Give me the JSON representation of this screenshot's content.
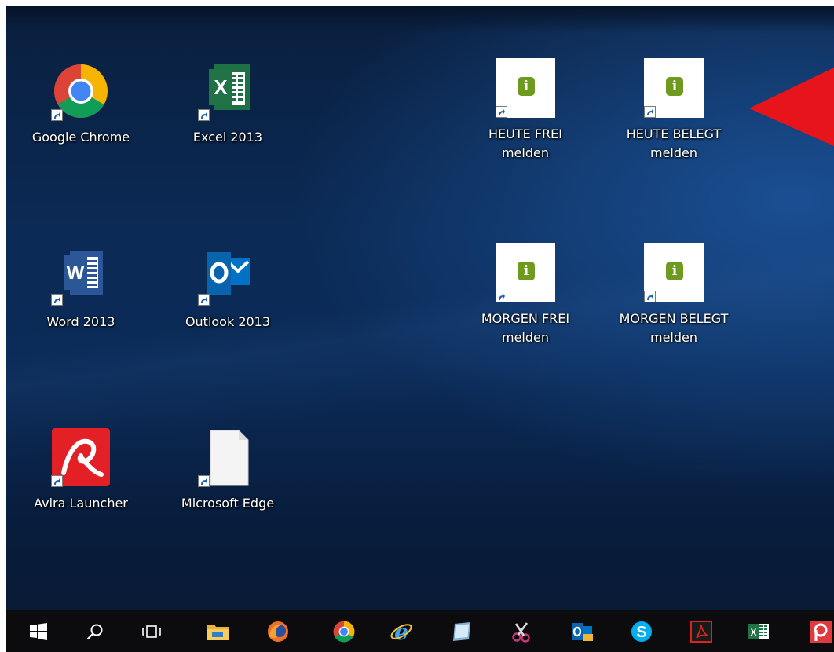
{
  "desktop": {
    "icons": [
      {
        "label": "Google Chrome",
        "icon": "chrome-icon"
      },
      {
        "label": "Excel 2013",
        "icon": "excel-icon"
      },
      {
        "label": "HEUTE FREI\nmelden",
        "icon": "info-icon"
      },
      {
        "label": "HEUTE BELEGT\nmelden",
        "icon": "info-icon"
      },
      {
        "label": "Word 2013",
        "icon": "word-icon"
      },
      {
        "label": "Outlook 2013",
        "icon": "outlook-icon"
      },
      {
        "label": "MORGEN FREI\nmelden",
        "icon": "info-icon"
      },
      {
        "label": "MORGEN BELEGT\nmelden",
        "icon": "info-icon"
      },
      {
        "label": "Avira Launcher",
        "icon": "avira-icon"
      },
      {
        "label": "Microsoft Edge",
        "icon": "blank-document-icon"
      }
    ],
    "annotation": {
      "icon": "red-arrow-icon",
      "color": "#e8141c"
    }
  },
  "taskbar": {
    "items": [
      {
        "icon": "windows-start-icon"
      },
      {
        "icon": "search-icon"
      },
      {
        "icon": "task-view-icon"
      },
      {
        "icon": "file-explorer-icon"
      },
      {
        "icon": "firefox-icon"
      },
      {
        "icon": "chrome-icon"
      },
      {
        "icon": "internet-explorer-icon"
      },
      {
        "icon": "notepad-icon"
      },
      {
        "icon": "snipping-tool-icon"
      },
      {
        "icon": "outlook-icon"
      },
      {
        "icon": "skype-icon"
      },
      {
        "icon": "acrobat-reader-icon"
      },
      {
        "icon": "excel-icon"
      },
      {
        "icon": "app-p-icon"
      }
    ]
  },
  "colors": {
    "desktop_background": "#0b2a55",
    "taskbar_background": "#0c0c0f",
    "info_green": "#6d9a1f",
    "excel_green": "#1e7145",
    "word_blue": "#2b579a",
    "outlook_blue": "#0072c6",
    "avira_red": "#e32026",
    "annotation_red": "#e8141c"
  }
}
